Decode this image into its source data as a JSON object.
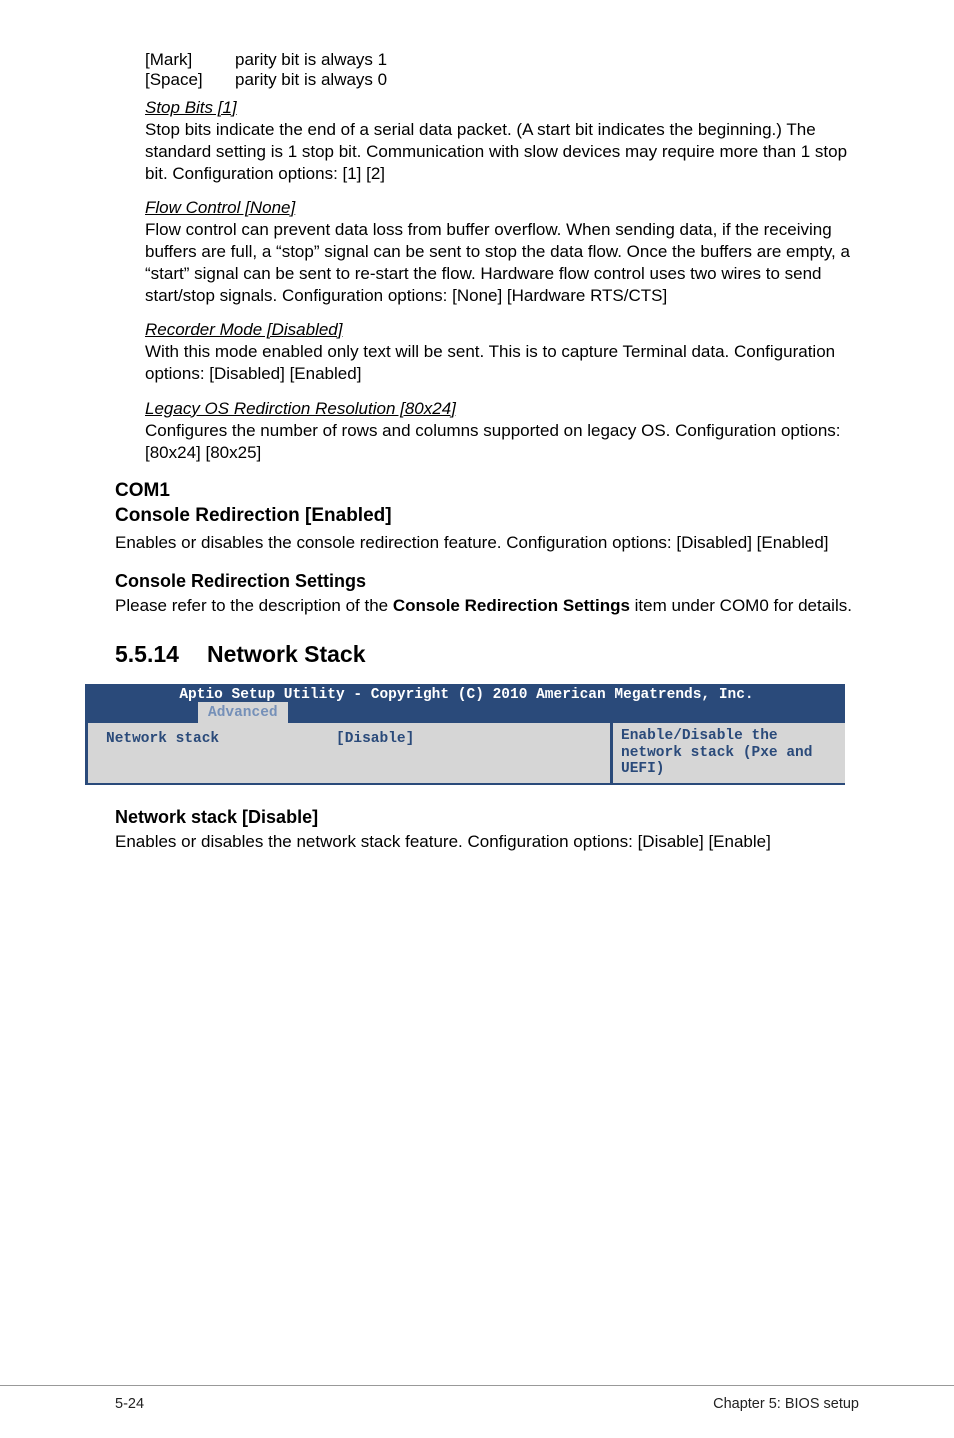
{
  "defs": {
    "mark_term": "[Mark]",
    "mark_desc": "parity bit is always 1",
    "space_term": "[Space]",
    "space_desc": "parity bit is always 0"
  },
  "stop_bits": {
    "title": "Stop Bits [1]",
    "body": "Stop bits indicate the end of a serial data packet. (A start bit indicates the beginning.) The standard setting is 1 stop bit. Communication with slow devices may require more than 1 stop bit. Configuration options: [1] [2]"
  },
  "flow_control": {
    "title": "Flow Control [None]",
    "body": "Flow control can prevent data loss from buffer overflow. When sending data, if the receiving buffers are full, a “stop” signal can be sent to stop the data flow. Once the buffers are empty, a “start” signal can be sent to re-start the flow. Hardware flow control uses two wires to send start/stop signals. Configuration options: [None] [Hardware RTS/CTS]"
  },
  "recorder_mode": {
    "title": "Recorder Mode [Disabled]",
    "body": "With this mode enabled only text will be sent. This is to capture Terminal data. Configuration options: [Disabled] [Enabled]"
  },
  "legacy_os": {
    "title": "Legacy OS Redirction Resolution [80x24]",
    "body": "Configures the number of rows and columns supported on legacy OS. Configuration options: [80x24] [80x25]"
  },
  "com1": {
    "line1": "COM1",
    "line2": "Console Redirection [Enabled]",
    "body": "Enables or disables the console redirection feature. Configuration options: [Disabled] [Enabled]"
  },
  "crs": {
    "title": "Console Redirection Settings",
    "body_pre": "Please refer to the description of the ",
    "body_bold": "Console Redirection Settings",
    "body_post": " item under COM0 for details."
  },
  "section": {
    "num": "5.5.14",
    "title": "Network Stack"
  },
  "bios": {
    "header": "Aptio Setup Utility - Copyright (C) 2010 American Megatrends, Inc.",
    "tab": "Advanced",
    "item_label": "Network stack",
    "item_value": "[Disable]",
    "help": "Enable/Disable the network stack (Pxe and UEFI)"
  },
  "nstack": {
    "title": "Network stack [Disable]",
    "body": "Enables or disables the network stack feature. Configuration options: [Disable] [Enable]"
  },
  "footer": {
    "left": "5-24",
    "right": "Chapter 5: BIOS setup"
  }
}
